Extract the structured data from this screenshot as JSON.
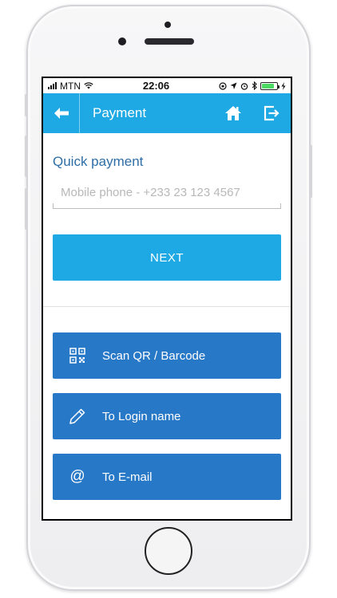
{
  "status_bar": {
    "carrier": "MTN",
    "time": "22:06",
    "battery_level": 0.85
  },
  "app_bar": {
    "title": "Payment",
    "icons": [
      "arrow-left-icon",
      "home-icon",
      "logout-icon"
    ]
  },
  "quick_payment": {
    "title": "Quick payment",
    "phone_placeholder": "Mobile phone - +233 23 123 4567",
    "phone_value": "",
    "next_label": "NEXT"
  },
  "actions": [
    {
      "label": "Scan QR / Barcode",
      "icon": "qr-code-icon"
    },
    {
      "label": "To Login name",
      "icon": "pencil-icon"
    },
    {
      "label": "To E-mail",
      "icon": "at-sign-icon",
      "glyph": "@"
    }
  ],
  "colors": {
    "app_bar": "#1ea8e4",
    "next_button": "#1ea8e4",
    "action_button": "#2878c8",
    "section_title": "#2e6ea6"
  }
}
